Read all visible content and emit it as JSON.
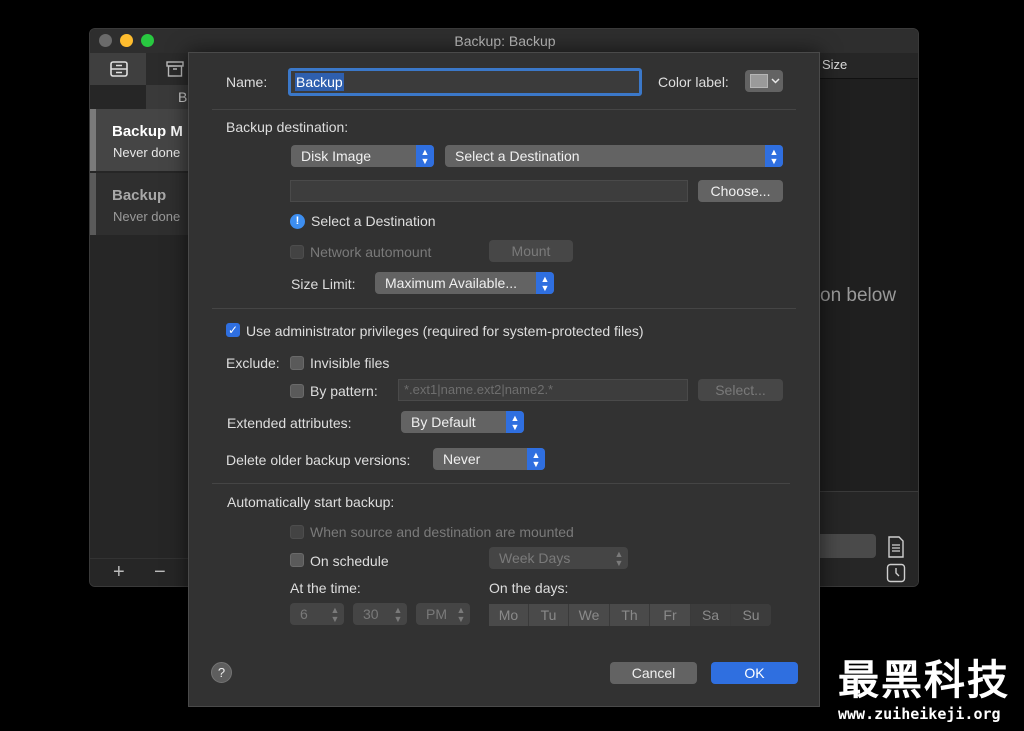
{
  "window": {
    "title": "Backup: Backup",
    "traffic_colors": [
      "#ff5f57",
      "#febc2e",
      "#28c840"
    ]
  },
  "sidebar": {
    "tab_partial_label": "B",
    "items": [
      {
        "title": "Backup M",
        "subtitle": "Never done"
      },
      {
        "title": "Backup",
        "subtitle": "Never done"
      }
    ],
    "add_label": "+",
    "remove_label": "−"
  },
  "right_pane": {
    "column_header": "Size",
    "hint_text": "on below"
  },
  "dialog": {
    "name_label": "Name:",
    "name_value": "Backup",
    "color_label": "Color label:",
    "backup_destination_label": "Backup destination:",
    "dest_type": "Disk Image",
    "dest_select": "Select a Destination",
    "choose_button": "Choose...",
    "dest_warning": "Select a Destination",
    "network_automount": "Network automount",
    "mount_button": "Mount",
    "size_limit_label": "Size Limit:",
    "size_limit_value": "Maximum Available...",
    "admin_privileges": "Use administrator privileges (required for system-protected files)",
    "exclude_label": "Exclude:",
    "invisible_files": "Invisible files",
    "by_pattern": "By pattern:",
    "pattern_placeholder": "*.ext1|name.ext2|name2.*",
    "select_button": "Select...",
    "extended_attributes_label": "Extended attributes:",
    "extended_attributes_value": "By Default",
    "delete_older_label": "Delete older backup versions:",
    "delete_older_value": "Never",
    "auto_start_label": "Automatically start backup:",
    "when_mounted": "When source and destination are mounted",
    "on_schedule": "On schedule",
    "schedule_value": "Week Days",
    "at_time_label": "At the time:",
    "hour": "6",
    "minute": "30",
    "ampm": "PM",
    "on_days_label": "On the days:",
    "days": [
      "Mo",
      "Tu",
      "We",
      "Th",
      "Fr",
      "Sa",
      "Su"
    ],
    "help_label": "?",
    "cancel_button": "Cancel",
    "ok_button": "OK",
    "accent_color": "#2f6fe0"
  },
  "watermark": {
    "title": "最黑科技",
    "url": "www.zuiheikeji.org"
  }
}
